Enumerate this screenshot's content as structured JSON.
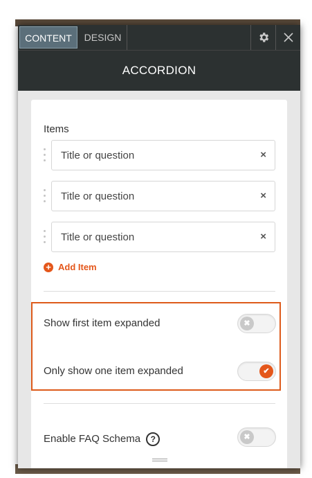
{
  "header": {
    "tabs": [
      {
        "label": "CONTENT",
        "active": true
      },
      {
        "label": "DESIGN",
        "active": false
      }
    ],
    "settings_icon": "gear-icon",
    "close_icon": "close-icon",
    "title": "ACCORDION"
  },
  "items": {
    "label": "Items",
    "list": [
      {
        "placeholder": "Title or question"
      },
      {
        "placeholder": "Title or question"
      },
      {
        "placeholder": "Title or question"
      }
    ],
    "remove_symbol": "×",
    "add_label": "Add Item",
    "add_symbol": "+"
  },
  "options": {
    "show_first": {
      "label": "Show first item expanded",
      "enabled": false,
      "symbol": "✖"
    },
    "only_one": {
      "label": "Only show one item expanded",
      "enabled": true,
      "symbol": "✔"
    },
    "faq_schema": {
      "label": "Enable FAQ Schema",
      "help_symbol": "?",
      "enabled": false,
      "symbol": "✖"
    }
  },
  "colors": {
    "accent": "#e4571b",
    "header_bg": "#2c3131",
    "active_tab_bg": "#5b6f7a"
  }
}
